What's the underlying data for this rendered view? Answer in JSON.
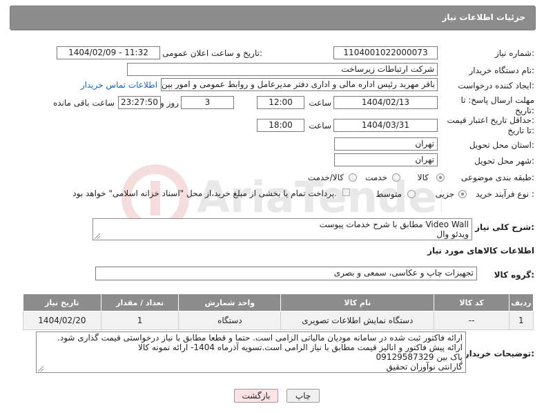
{
  "header": {
    "title": "جزئیات اطلاعات نیاز"
  },
  "fields": {
    "need_number_label": "شماره نیاز:",
    "need_number": "1104001022000073",
    "announce_label": "تاریخ و ساعت اعلان عمومی:",
    "announce_value": "1404/02/09 - 11:32",
    "buyer_org_label": "نام دستگاه خریدار:",
    "buyer_org": "شرکت ارتباطات زیرساخت",
    "creator_label": "ایجاد کننده درخواست:",
    "creator": "باقر مهربد رئیس اداره مالی و اداری دفتر مدیرعامل و روابط عمومی و امور بین الم",
    "contact_link": "اطلاعات تماس خریدار",
    "deadline_label_1": "مهلت ارسال پاسخ: تا",
    "deadline_label_2": "تاریخ:",
    "deadline_date": "1404/02/13",
    "time_label": "ساعت",
    "deadline_time": "12:00",
    "days": "3",
    "day_and_label": "روز و",
    "remaining_time": "23:27:50",
    "remaining_label": "ساعت باقی مانده",
    "min_validity_label_1": "حداقل تاریخ اعتبار قیمت:",
    "min_validity_label_2": "تا تاریخ:",
    "validity_date": "1404/03/31",
    "validity_time": "18:00",
    "province_label": "استان محل تحویل:",
    "province": "تهران",
    "city_label": "شهر محل تحویل:",
    "city": "تهران",
    "category_label": "طبقه بندی موضوعی:",
    "category_options": [
      "کالا",
      "خدمت",
      "کالا/خدمت"
    ],
    "process_label": "نوع فرآیند خرید :",
    "process_options": [
      "جزیی",
      "متوسط"
    ],
    "payment_note": "پرداخت تمام یا بخشی از مبلغ خرید،از محل \"اسناد خزانه اسلامی\" خواهد بود.",
    "description_label": "شرح کلی نیاز:",
    "description_lines": [
      "Video Wall مطابق با شرح خدمات پیوست",
      "ویدئو وال"
    ]
  },
  "goods": {
    "section_title": "اطلاعات کالاهای مورد نیاز",
    "group_label": "گروه کالا:",
    "group_value": "تجهیزات چاپ و عکاسی، سمعی و بصری",
    "columns": [
      "ردیف",
      "کد کالا",
      "نام کالا",
      "واحد شمارش",
      "تعداد / مقدار",
      "تاریخ نیاز"
    ],
    "rows": [
      [
        "1",
        "--",
        "دستگاه نمایش اطلاعات تصویری",
        "دستگاه",
        "1",
        "1404/02/20"
      ]
    ]
  },
  "buyer_notes": {
    "label": "توضیحات خریدار:",
    "lines": [
      "ارائه فاکتور ثبت شده در سامانه مودیان مالیاتی الزامی است. حتما و قطعا مطابق با نیاز درخواستی قیمت گذاری شود.",
      "ارائه پیش فاکتور و انالیز قیمت مطابق با نیاز الزامی است.تسویه آذرماه 1404- ارائه نمونه کالا",
      "پاک بین 09129587329",
      "گارانتی نوآوران تحقیق"
    ]
  },
  "buttons": {
    "print": "چاپ",
    "back": "بازگشت"
  },
  "watermark": {
    "text": "AriaTender.neT"
  },
  "colors": {
    "header_bg": "#8c8c8c",
    "link": "#1565c0",
    "back_button_bg": "#fde3e3"
  }
}
